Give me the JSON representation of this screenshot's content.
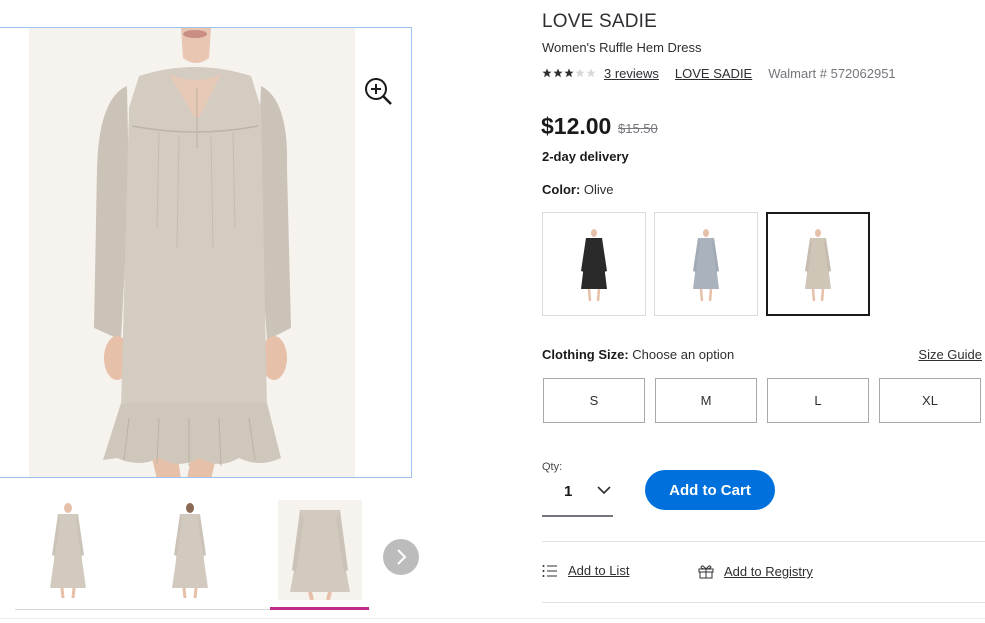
{
  "product": {
    "brand": "LOVE SADIE",
    "name": "Women's Ruffle Hem Dress",
    "rating_stars": 3,
    "rating_max": 5,
    "reviews_label": "3 reviews",
    "brand_link": "LOVE SADIE",
    "walmart_number": "Walmart # 572062951",
    "price": "$12.00",
    "was_price": "$15.50",
    "delivery": "2-day delivery"
  },
  "color": {
    "label": "Color:",
    "selected": "Olive",
    "swatches": [
      {
        "name": "black",
        "dress_color": "#2a2a2a"
      },
      {
        "name": "gray-blue",
        "dress_color": "#aab3bd"
      },
      {
        "name": "olive",
        "dress_color": "#cfc6b8",
        "selected": true
      }
    ]
  },
  "size": {
    "label": "Clothing Size:",
    "prompt": "Choose an option",
    "guide_label": "Size Guide",
    "options": [
      "S",
      "M",
      "L",
      "XL"
    ]
  },
  "quantity": {
    "label": "Qty:",
    "value": "1"
  },
  "cart": {
    "add_label": "Add to Cart",
    "accent": "#0071dc"
  },
  "actions": {
    "add_to_list": "Add to List",
    "add_to_registry": "Add to Registry"
  },
  "gallery": {
    "selected_thumb": 3,
    "thumb_count": 3,
    "selected_bar_color": "#c12e8a",
    "zoom_icon": "zoom-in-icon",
    "next_icon": "chevron-right-icon"
  }
}
